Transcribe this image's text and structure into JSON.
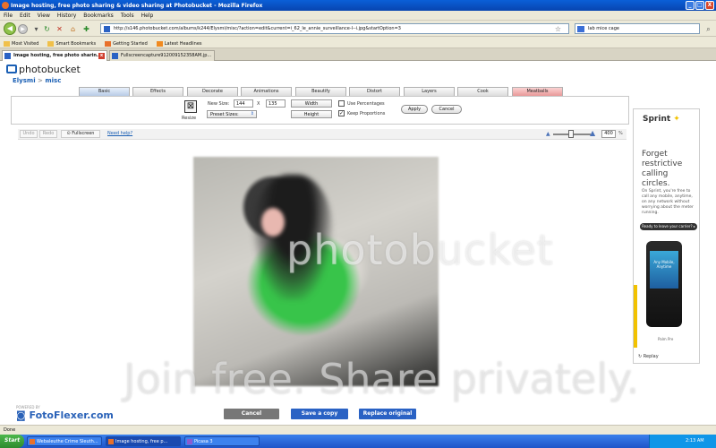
{
  "window": {
    "title": "Image hosting, free photo sharing & video sharing at Photobucket - Mozilla Firefox",
    "buttons": [
      "_",
      "□",
      "X"
    ]
  },
  "menu": [
    "File",
    "Edit",
    "View",
    "History",
    "Bookmarks",
    "Tools",
    "Help"
  ],
  "nav": {
    "url": "http://s146.photobucket.com/albums/k244/Elysmi/misc/?action=edit&current=i_62_le_annie_surveillance-l--i.jpg&startOption=3",
    "search_placeholder": "lab mice cage"
  },
  "bookmarks": [
    "Most Visited",
    "Smart Bookmarks",
    "Getting Started",
    "Latest Headlines"
  ],
  "tabs": [
    {
      "label": "Image hosting, free photo sharin...",
      "active": true
    },
    {
      "label": "Fullscreencapture912009152358AM.jp...",
      "active": false
    }
  ],
  "photobucket": {
    "logo": "photobucket",
    "user": "Elysmi",
    "separator": ">",
    "album": "misc"
  },
  "editor_tabs": [
    "Basic",
    "Effects",
    "Decorate",
    "Animations",
    "Beautify",
    "Distort",
    "Layers",
    "Cook",
    "Meatballs"
  ],
  "resize": {
    "label": "Resize",
    "new_size_label": "New Size:",
    "width_value": "144",
    "times": "X",
    "height_value": "135",
    "preset_label": "Preset Sizes:",
    "width_label": "Width",
    "height_label": "Height",
    "use_percentages": "Use Percentages",
    "keep_proportions": "Keep Proportions",
    "apply": "Apply",
    "cancel": "Cancel"
  },
  "subbar": {
    "undo": "Undo",
    "redo": "Redo",
    "fullscreen": "Fullscreen",
    "need_help": "Need help?",
    "zoom": "400",
    "pct": "%"
  },
  "watermark": {
    "brand": "photobucket",
    "tagline": "Join free. Share privately."
  },
  "fotoflexer": {
    "powered": "POWERED BY",
    "name": "FotoFlexer.com"
  },
  "bottom_buttons": {
    "cancel": "Cancel",
    "save_copy": "Save a copy",
    "replace": "Replace original"
  },
  "ad": {
    "brand": "Sprint",
    "headline": "Forget restrictive calling circles.",
    "body": "On Sprint, you're free to call any mobile, anytime, on any network without worrying about the meter running.",
    "cta": "Ready to leave your carrier? ▸",
    "screen_text": "Any Mobile, Anytime",
    "phone_brand": "Palm Pre",
    "replay": "Replay"
  },
  "status": "Done",
  "taskbar": {
    "start": "Start",
    "tasks": [
      "Webaleuthe Crime Sleuth...",
      "Image hosting, free p...",
      "Picasa 3"
    ],
    "clock": "2:13 AM"
  },
  "colors": {
    "accent": "#1a5fb4",
    "tab_active": "#b8cbe6",
    "tab_special": "#e89898",
    "cancel_btn": "#777777",
    "primary_btn": "#2a62c4"
  }
}
